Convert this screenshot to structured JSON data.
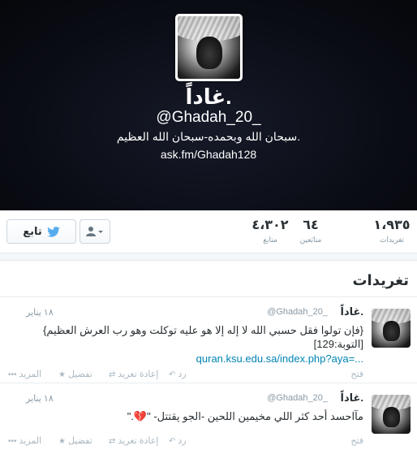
{
  "profile": {
    "display_name": "غاداً.",
    "handle": "@Ghadah_20_",
    "bio": "سبحان الله وبحمده-سبحان الله العظيم.",
    "url": "ask.fm/Ghadah128"
  },
  "stats": {
    "tweets_value": "١،٩٣٥",
    "tweets_label": "تغريدات",
    "following_value": "٦٤",
    "following_label": "متابَعين",
    "followers_value": "٤،٣٠٢",
    "followers_label": "متابع"
  },
  "buttons": {
    "follow_label": "تابع",
    "user_menu_icon": "person-caret-icon"
  },
  "tweets_section": {
    "title": "تغريدات",
    "items": [
      {
        "name": "غاداً.",
        "handle": "@Ghadah_20_",
        "date": "١٨ يناير",
        "text": "{فإن تولوا فقل حسبي الله لا إله إلا هو عليه توكلت وهو رب العرش العظيم} [التوبة:129]",
        "link": "quran.ksu.edu.sa/index.php?aya=..."
      },
      {
        "name": "غاداً.",
        "handle": "@Ghadah_20_",
        "date": "١٨ يناير",
        "text": "مآاحسد أحد كثر اللي مخيمين اللحين -الجو يقتتل- \"💔.\""
      }
    ],
    "actions": {
      "open": "فتح",
      "reply": "رد",
      "retweet": "إعادة تغريد",
      "favorite": "تفضيل",
      "more": "المزيد"
    }
  },
  "colors": {
    "header_bg": "#0a0c14",
    "link": "#0084b4",
    "twitter_blue": "#55acee"
  }
}
